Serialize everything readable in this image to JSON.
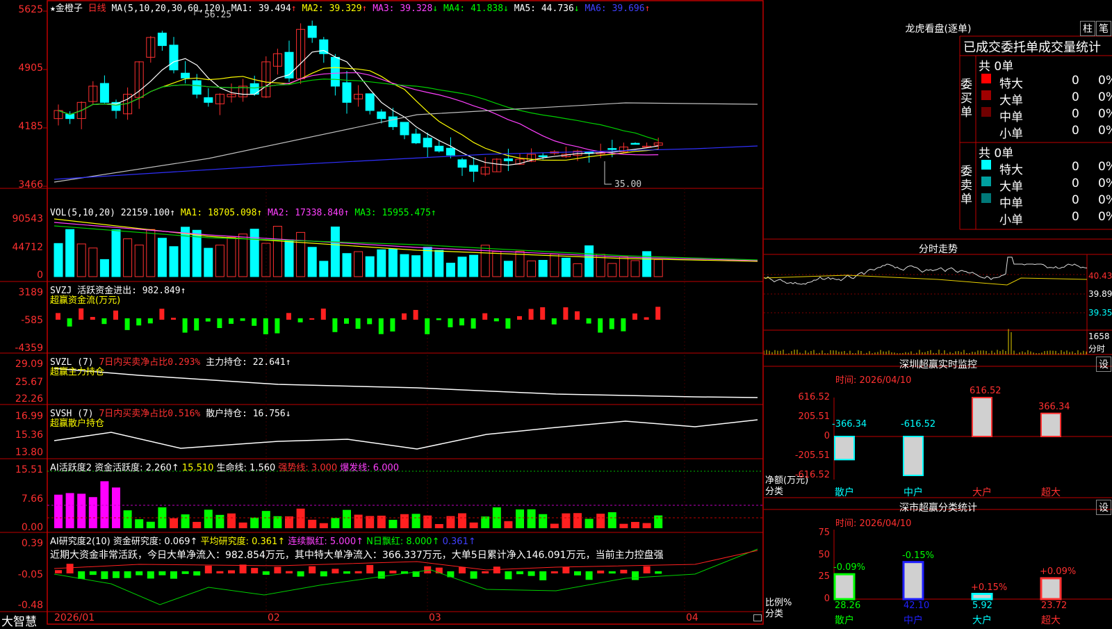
{
  "app": {
    "brand": "大智慧",
    "stock_name": "★金橙子",
    "period": "日线"
  },
  "main_header": {
    "ma_label": "MA(5,10,20,30,60,120)",
    "ma1": "MA1: 39.494",
    "ma1_arrow": "↑",
    "ma2": "MA2: 39.329",
    "ma2_arrow": "↑",
    "ma3": "MA3: 39.328",
    "ma3_arrow": "↓",
    "ma4": "MA4: 41.838",
    "ma4_arrow": "↓",
    "ma5": "MA5: 44.736",
    "ma5_arrow": "↓",
    "ma6": "MA6: 39.696",
    "ma6_arrow": "↑",
    "high_note": "56.25",
    "low_note": "35.00"
  },
  "main_yaxis": [
    "5625",
    "4905",
    "4185",
    "3466"
  ],
  "vol_header": {
    "label": "VOL(5,10,20)",
    "value": "22159.100↑",
    "ma1": "MA1: 18705.098↑",
    "ma2": "MA2: 17338.840↑",
    "ma3": "MA3: 15955.475↑"
  },
  "vol_yaxis": [
    "90543",
    "44712",
    "0"
  ],
  "svzj": {
    "label": "SVZJ",
    "title": "活跃资金进出: 982.849↑",
    "sub": "超赢资金流(万元)",
    "yaxis": [
      "3189",
      "-585",
      "-4359"
    ]
  },
  "svzl": {
    "label": "SVZL (7)",
    "ratio": "7日内买卖净占比0.293%",
    "hold": "主力持仓: 22.641↑",
    "sub": "超赢主力持仓",
    "yaxis": [
      "29.09",
      "25.67",
      "22.26"
    ]
  },
  "svsh": {
    "label": "SVSH (7)",
    "ratio": "7日内买卖净占比0.516%",
    "hold": "散户持仓: 16.756↓",
    "sub": "超赢散户持仓",
    "yaxis": [
      "16.99",
      "15.36",
      "13.80"
    ]
  },
  "ai_active": {
    "label": "AI活跃度2",
    "a": "资金活跃度: 2.260↑",
    "b": "15.510",
    "c": "生命线: 1.560",
    "d": "强势线: 3.000",
    "e": "爆发线: 6.000",
    "yaxis": [
      "15.51",
      "7.66",
      "0.00"
    ]
  },
  "ai_research": {
    "label": "AI研究度2(10)",
    "a": "资金研究度: 0.069↑",
    "b": "平均研究度: 0.361↑",
    "c": "连续飘红: 5.000↑",
    "d": "N日飘红: 8.000↑",
    "e": "0.361↑",
    "comment": "近期大资金非常活跃，今日大单净流入：982.854万元，其中特大单净流入：366.337万元，大单5日累计净入146.091万元，当前主力控盘强",
    "yaxis": [
      "0.39",
      "-0.05",
      "-0.48"
    ]
  },
  "xaxis": [
    "2026/01",
    "02",
    "03",
    "04"
  ],
  "right": {
    "dragon_title": "龙虎看盘(逐单)",
    "btn_zhu": "柱",
    "btn_bi": "笔",
    "table_title": "已成交委托单成交量统计",
    "buy_label": "委买单",
    "sell_label": "委卖单",
    "buy_total": "共 0单",
    "sell_total": "共 0单",
    "rows": [
      {
        "name": "特大",
        "count": "0",
        "pct": "0%"
      },
      {
        "name": "大单",
        "count": "0",
        "pct": "0%"
      },
      {
        "name": "中单",
        "count": "0",
        "pct": "0%"
      },
      {
        "name": "小单",
        "count": "0",
        "pct": "0%"
      }
    ],
    "fenshi_title": "分时走势",
    "fenshi_prices": [
      "40.43",
      "39.89",
      "39.35"
    ],
    "fenshi_vol": [
      "1658",
      "分时"
    ],
    "monitor_title": "深圳超赢实时监控",
    "monitor_time": "时间: 2026/04/10",
    "monitor_ylab": "净额(万元)",
    "monitor_xlab": "分类",
    "stats_title": "深市超赢分类统计",
    "stats_time": "时间: 2026/04/10",
    "stats_ylab": "比例%",
    "stats_xlab": "分类",
    "btn_set": "设"
  },
  "chart_data": [
    {
      "type": "bar",
      "title": "深圳超赢实时监控",
      "categories": [
        "散户",
        "中户",
        "大户",
        "超大"
      ],
      "values": [
        -366.34,
        -616.52,
        616.52,
        366.34
      ],
      "ylim": [
        -616.52,
        616.52
      ],
      "yticks": [
        "616.52",
        "205.51",
        "0",
        "-205.51",
        "-616.52"
      ]
    },
    {
      "type": "bar",
      "title": "深市超赢分类统计",
      "categories": [
        "散户",
        "中户",
        "大户",
        "超大"
      ],
      "values": [
        28.26,
        42.1,
        5.92,
        23.72
      ],
      "changes": [
        "-0.09%",
        "-0.15%",
        "+0.15%",
        "+0.09%"
      ],
      "ylim": [
        0,
        75
      ],
      "yticks": [
        "75",
        "50",
        "25",
        "0"
      ]
    }
  ]
}
